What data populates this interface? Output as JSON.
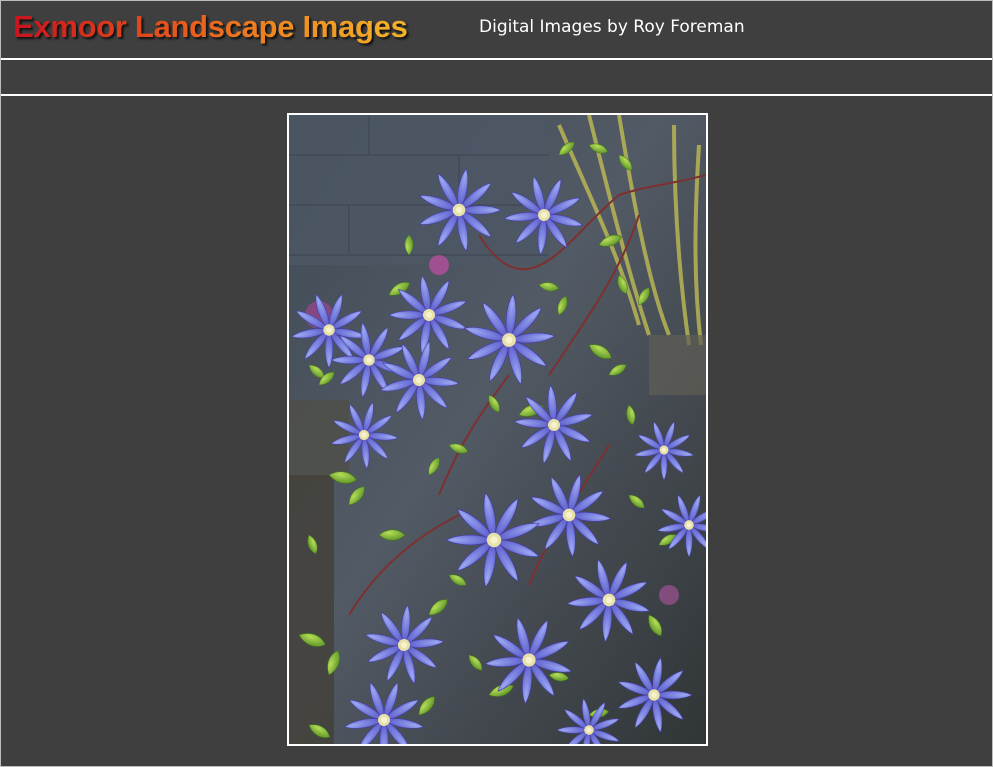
{
  "header": {
    "title": "Exmoor Landscape Images",
    "subtitle": "Digital Images by Roy Foreman"
  },
  "colors": {
    "background": "#3f3f3f",
    "rule": "#ffffff",
    "title_gradient_start": "#c8141e",
    "title_gradient_end": "#f3b42a",
    "subtitle": "#ffffff",
    "flower_blue": "#6a6fd6",
    "leaf_green": "#7fb532"
  },
  "main": {
    "photo": {
      "subject_icon": "clematis-flowers-photo"
    }
  }
}
